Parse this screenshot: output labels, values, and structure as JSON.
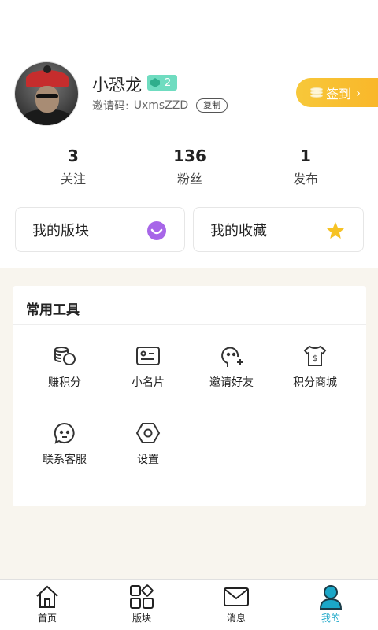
{
  "profile": {
    "username": "小恐龙",
    "level": "2",
    "invite_label": "邀请码:",
    "invite_code": "UxmsZZD",
    "copy_label": "复制",
    "signin_label": "签到"
  },
  "stats": [
    {
      "value": "3",
      "label": "关注"
    },
    {
      "value": "136",
      "label": "粉丝"
    },
    {
      "value": "1",
      "label": "发布"
    }
  ],
  "cards": {
    "my_sections": "我的版块",
    "my_favorites": "我的收藏"
  },
  "tools": {
    "title": "常用工具",
    "items": [
      {
        "label": "赚积分",
        "icon": "coins-icon"
      },
      {
        "label": "小名片",
        "icon": "id-card-icon"
      },
      {
        "label": "邀请好友",
        "icon": "invite-friend-icon"
      },
      {
        "label": "积分商城",
        "icon": "points-mall-icon"
      },
      {
        "label": "联系客服",
        "icon": "customer-service-icon"
      },
      {
        "label": "设置",
        "icon": "settings-icon"
      }
    ]
  },
  "nav": {
    "items": [
      {
        "label": "首页",
        "icon": "home-icon"
      },
      {
        "label": "版块",
        "icon": "sections-icon"
      },
      {
        "label": "消息",
        "icon": "message-icon"
      },
      {
        "label": "我的",
        "icon": "profile-icon"
      }
    ],
    "active": 3
  },
  "colors": {
    "accent": "#1ba7c8",
    "signin": "#f7c83a",
    "level_badge": "#6fdcc0",
    "background_section": "#f8f5ee"
  }
}
